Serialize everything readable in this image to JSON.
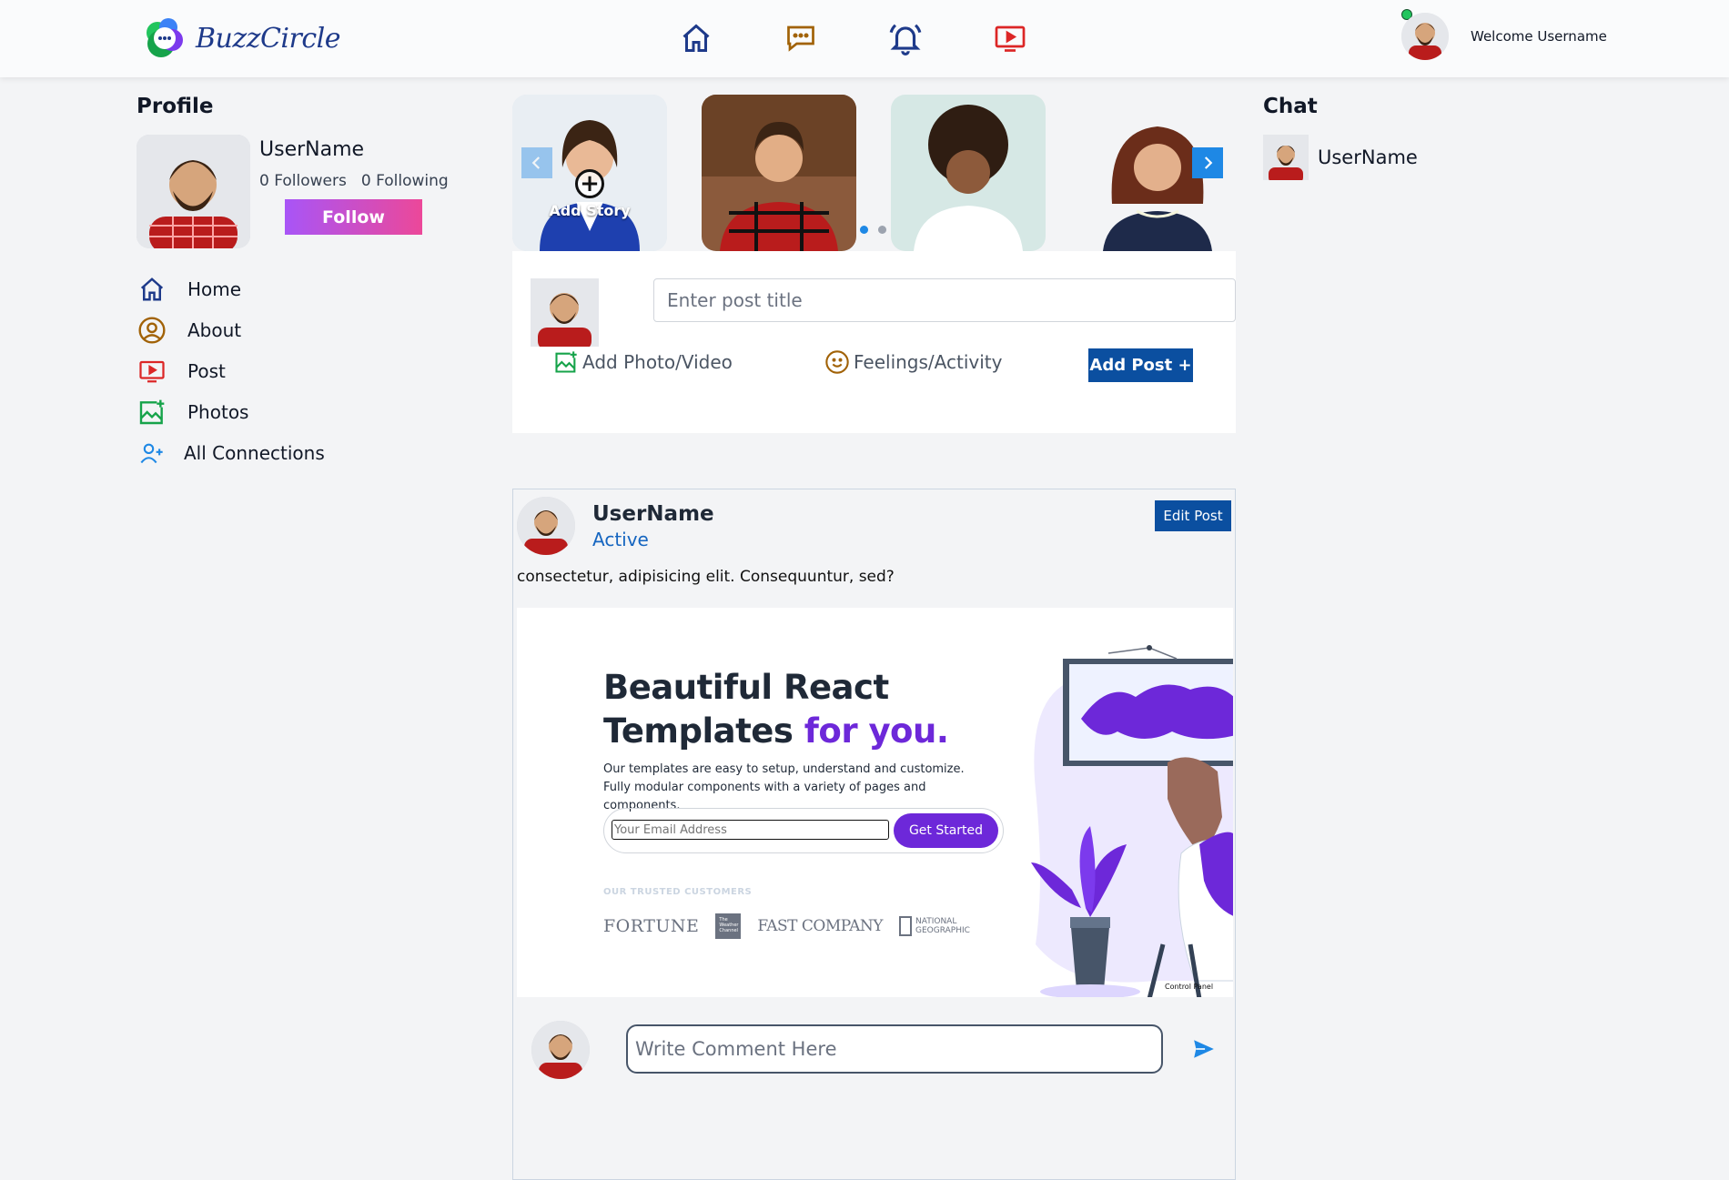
{
  "header": {
    "brand": "BuzzCircle",
    "welcome_text": "Welcome Username",
    "nav": [
      {
        "name": "home",
        "icon": "home-icon"
      },
      {
        "name": "messages",
        "icon": "chat-bubble-icon"
      },
      {
        "name": "notifications",
        "icon": "bell-icon"
      },
      {
        "name": "videos",
        "icon": "video-play-icon"
      }
    ]
  },
  "profile": {
    "section_title": "Profile",
    "name": "UserName",
    "followers": "0 Followers",
    "following": "0 Following",
    "follow_label": "Follow"
  },
  "menu": {
    "items": [
      {
        "label": "Home",
        "icon": "home-icon",
        "color": "#1e3a8a"
      },
      {
        "label": "About",
        "icon": "user-circle-icon",
        "color": "#a16207"
      },
      {
        "label": "Post",
        "icon": "video-play-icon",
        "color": "#dc2626"
      },
      {
        "label": "Photos",
        "icon": "add-photo-icon",
        "color": "#16a34a"
      },
      {
        "label": "All Connections",
        "icon": "add-user-icon",
        "color": "#1e88e5"
      }
    ]
  },
  "stories": {
    "add_label": "Add Story",
    "active_dot": 0,
    "dot_count": 2
  },
  "composer": {
    "title_placeholder": "Enter post title",
    "photo_label": "Add Photo/Video",
    "feelings_label": "Feelings/Activity",
    "add_post_label": "Add Post +"
  },
  "post": {
    "user": "UserName",
    "status": "Active",
    "edit_label": "Edit Post",
    "text": "consectetur, adipisicing elit. Consequuntur, sed?",
    "media": {
      "headline_line1": "Beautiful React",
      "headline_line2a": "Templates ",
      "headline_line2b": "for you.",
      "subtext": "Our templates are easy to setup, understand and customize. Fully modular components with a variety of pages and components.",
      "email_placeholder": "Your Email Address",
      "cta_label": "Get Started",
      "trusted_label": "OUR TRUSTED CUSTOMERS",
      "logos": [
        "FORTUNE",
        "The Weather Channel",
        "FAST COMPANY",
        "NATIONAL GEOGRAPHIC"
      ],
      "control_panel_label": "Control Panel"
    },
    "comment_placeholder": "Write Comment Here"
  },
  "chat": {
    "section_title": "Chat",
    "contacts": [
      {
        "name": "UserName"
      }
    ]
  },
  "colors": {
    "primary": "#0b4fa0",
    "accent_blue": "#1e88e5",
    "purple": "#6d28d9",
    "follow_gradient_start": "#a855f7",
    "follow_gradient_end": "#ec4899",
    "online": "#22c55e"
  }
}
